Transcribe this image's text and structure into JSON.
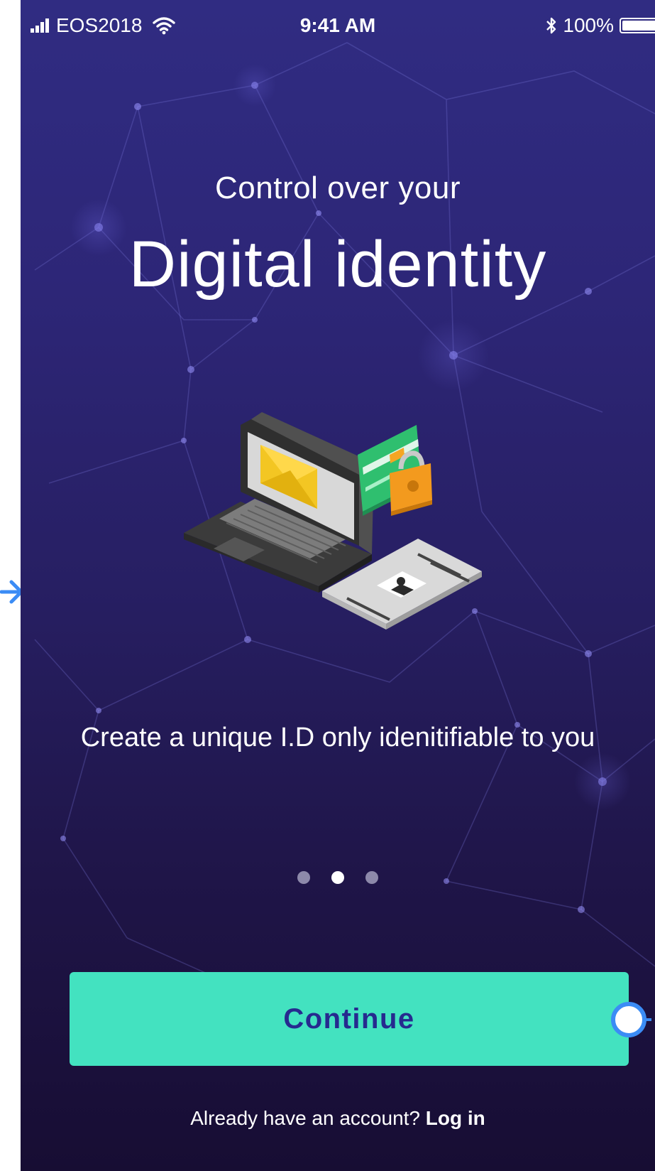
{
  "status_bar": {
    "carrier": "EOS2018",
    "time": "9:41 AM",
    "battery": "100%"
  },
  "hero": {
    "subtitle": "Control over your",
    "title": "Digital identity"
  },
  "illustration": {
    "icon": "laptop-id-card-lock-illustration"
  },
  "caption": "Create a unique I.D only idenitifiable to you",
  "pager": {
    "total": 3,
    "active_index": 1
  },
  "continue_label": "Continue",
  "login": {
    "prompt": "Already have an account?",
    "link_label": "Log in"
  },
  "colors": {
    "background_top": "#302c82",
    "background_bottom": "#170d33",
    "accent": "#43e2c0",
    "button_text": "#262a8f",
    "prototype_link": "#3b8cf5"
  }
}
